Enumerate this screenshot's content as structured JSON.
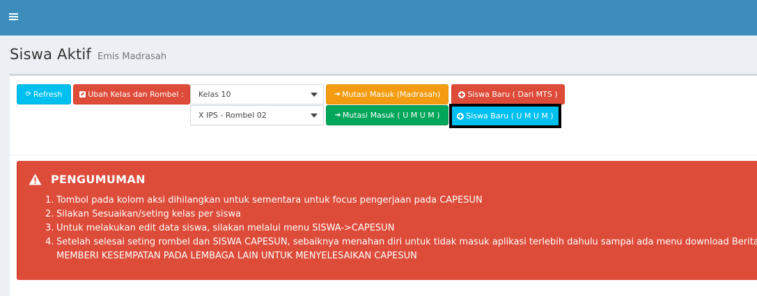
{
  "header": {
    "menu_icon": "hamburger-icon"
  },
  "page": {
    "title": "Siswa Aktif",
    "subtitle": "Emis Madrasah"
  },
  "toolbar": {
    "refresh_label": "Refresh",
    "ubah_label": "Ubah Kelas dan Rombel :",
    "mutasi_madrasah_label": "Mutasi Masuk (Madrasah)",
    "siswa_mts_label": "Siswa Baru ( Dari MTS )",
    "mutasi_umum_label": "Mutasi Masuk ( U M U M )",
    "siswa_umum_label": "Siswa Baru ( U M U M )",
    "kelas_selected": "Kelas 10",
    "rombel_selected": "X IPS - Rombel 02"
  },
  "announcement": {
    "title": "PENGUMUMAN",
    "items": [
      {
        "num": "1.",
        "text": "Tombol pada kolom aksi dihilangkan untuk sementara untuk focus pengerjaan pada CAPESUN"
      },
      {
        "num": "2.",
        "text": "Silakan Sesuaikan/seting kelas per siswa"
      },
      {
        "num": "3.",
        "text": "Untuk melakukan edit data siswa, silakan melalui menu SISWA->CAPESUN"
      },
      {
        "num": "4.",
        "text": "Setelah selesai seting rombel dan SISWA CAPESUN, sebaiknya menahan diri untuk tidak masuk aplikasi terlebih dahulu sampai ada menu download Berita acara",
        "text2": "MEMBERI KESEMPATAN PADA LEMBAGA LAIN UNTUK MENYELESAIKAN CAPESUN"
      }
    ]
  },
  "colors": {
    "header_blue": "#3c8dbc",
    "info": "#00c0ef",
    "danger": "#dd4b39",
    "warning": "#f39c12",
    "success": "#00a65a"
  }
}
